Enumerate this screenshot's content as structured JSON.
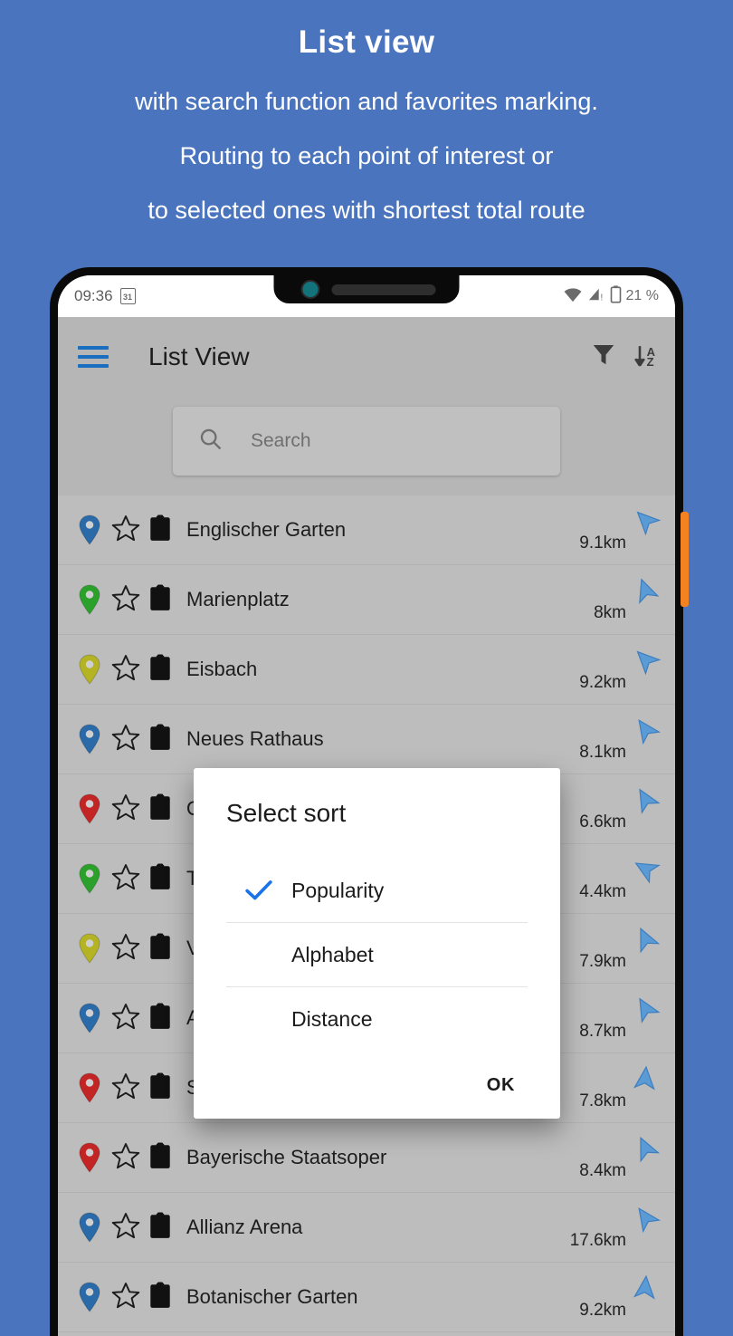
{
  "promo": {
    "title": "List view",
    "line1": "with search function and favorites marking.",
    "line2": "Routing to each point of interest or",
    "line3": "to selected ones with shortest total route",
    "background_color": "#4a74bd",
    "text_color": "#ffffff"
  },
  "device": {
    "frame_color": "#0a0a0a",
    "power_button_color": "#f58220",
    "camera_color": "#12737a"
  },
  "statusbar": {
    "time": "09:36",
    "calendar_day": "31",
    "battery_level": "21 %",
    "icons": [
      "wifi-icon",
      "cell-signal-icon",
      "battery-icon"
    ]
  },
  "appbar": {
    "title": "List View",
    "menu_icon": "hamburger-menu-icon",
    "menu_icon_color": "#1a6ec0",
    "filter_icon": "filter-funnel-icon",
    "sort_icon": "sort-az-icon",
    "sort_icon_letters": [
      "A",
      "Z"
    ],
    "background_color": "#b6b6b6"
  },
  "search": {
    "placeholder": "Search",
    "value": "",
    "icon": "search-icon"
  },
  "list": {
    "row_icons": [
      "map-pin-icon",
      "star-outline-icon",
      "clipboard-icon",
      "navigation-arrow-icon"
    ],
    "pin_colors": {
      "blue": "#2a6aa8",
      "green": "#2ba12b",
      "olive": "#b3b324",
      "red": "#c32424"
    },
    "arrow_color": "#5a9bd5",
    "items": [
      {
        "name": "Englischer Garten",
        "distance": "9.1km",
        "pin": "blue",
        "favorite": false,
        "arrow_deg": 135
      },
      {
        "name": "Marienplatz",
        "distance": "8km",
        "pin": "green",
        "favorite": false,
        "arrow_deg": 160
      },
      {
        "name": "Eisbach",
        "distance": "9.2km",
        "pin": "olive",
        "favorite": false,
        "arrow_deg": 135
      },
      {
        "name": "Neues Rathaus",
        "distance": "8.1km",
        "pin": "blue",
        "favorite": false,
        "arrow_deg": 145
      },
      {
        "name": "O",
        "distance": "6.6km",
        "pin": "red",
        "favorite": false,
        "arrow_deg": 150
      },
      {
        "name": "T",
        "distance": "4.4km",
        "pin": "green",
        "favorite": false,
        "arrow_deg": 120
      },
      {
        "name": "V",
        "distance": "7.9km",
        "pin": "olive",
        "favorite": false,
        "arrow_deg": 155
      },
      {
        "name": "A",
        "distance": "8.7km",
        "pin": "blue",
        "favorite": false,
        "arrow_deg": 150
      },
      {
        "name": "S",
        "distance": "7.8km",
        "pin": "red",
        "favorite": false,
        "arrow_deg": 185
      },
      {
        "name": "Bayerische Staatsoper",
        "distance": "8.4km",
        "pin": "red",
        "favorite": false,
        "arrow_deg": 155
      },
      {
        "name": "Allianz Arena",
        "distance": "17.6km",
        "pin": "blue",
        "favorite": false,
        "arrow_deg": 145
      },
      {
        "name": "Botanischer Garten",
        "distance": "9.2km",
        "pin": "blue",
        "favorite": false,
        "arrow_deg": 185
      }
    ]
  },
  "dialog": {
    "title": "Select sort",
    "options": [
      {
        "label": "Popularity",
        "selected": true
      },
      {
        "label": "Alphabet",
        "selected": false
      },
      {
        "label": "Distance",
        "selected": false
      }
    ],
    "ok_label": "OK",
    "check_icon": "check-icon",
    "check_color": "#1a73e8"
  }
}
